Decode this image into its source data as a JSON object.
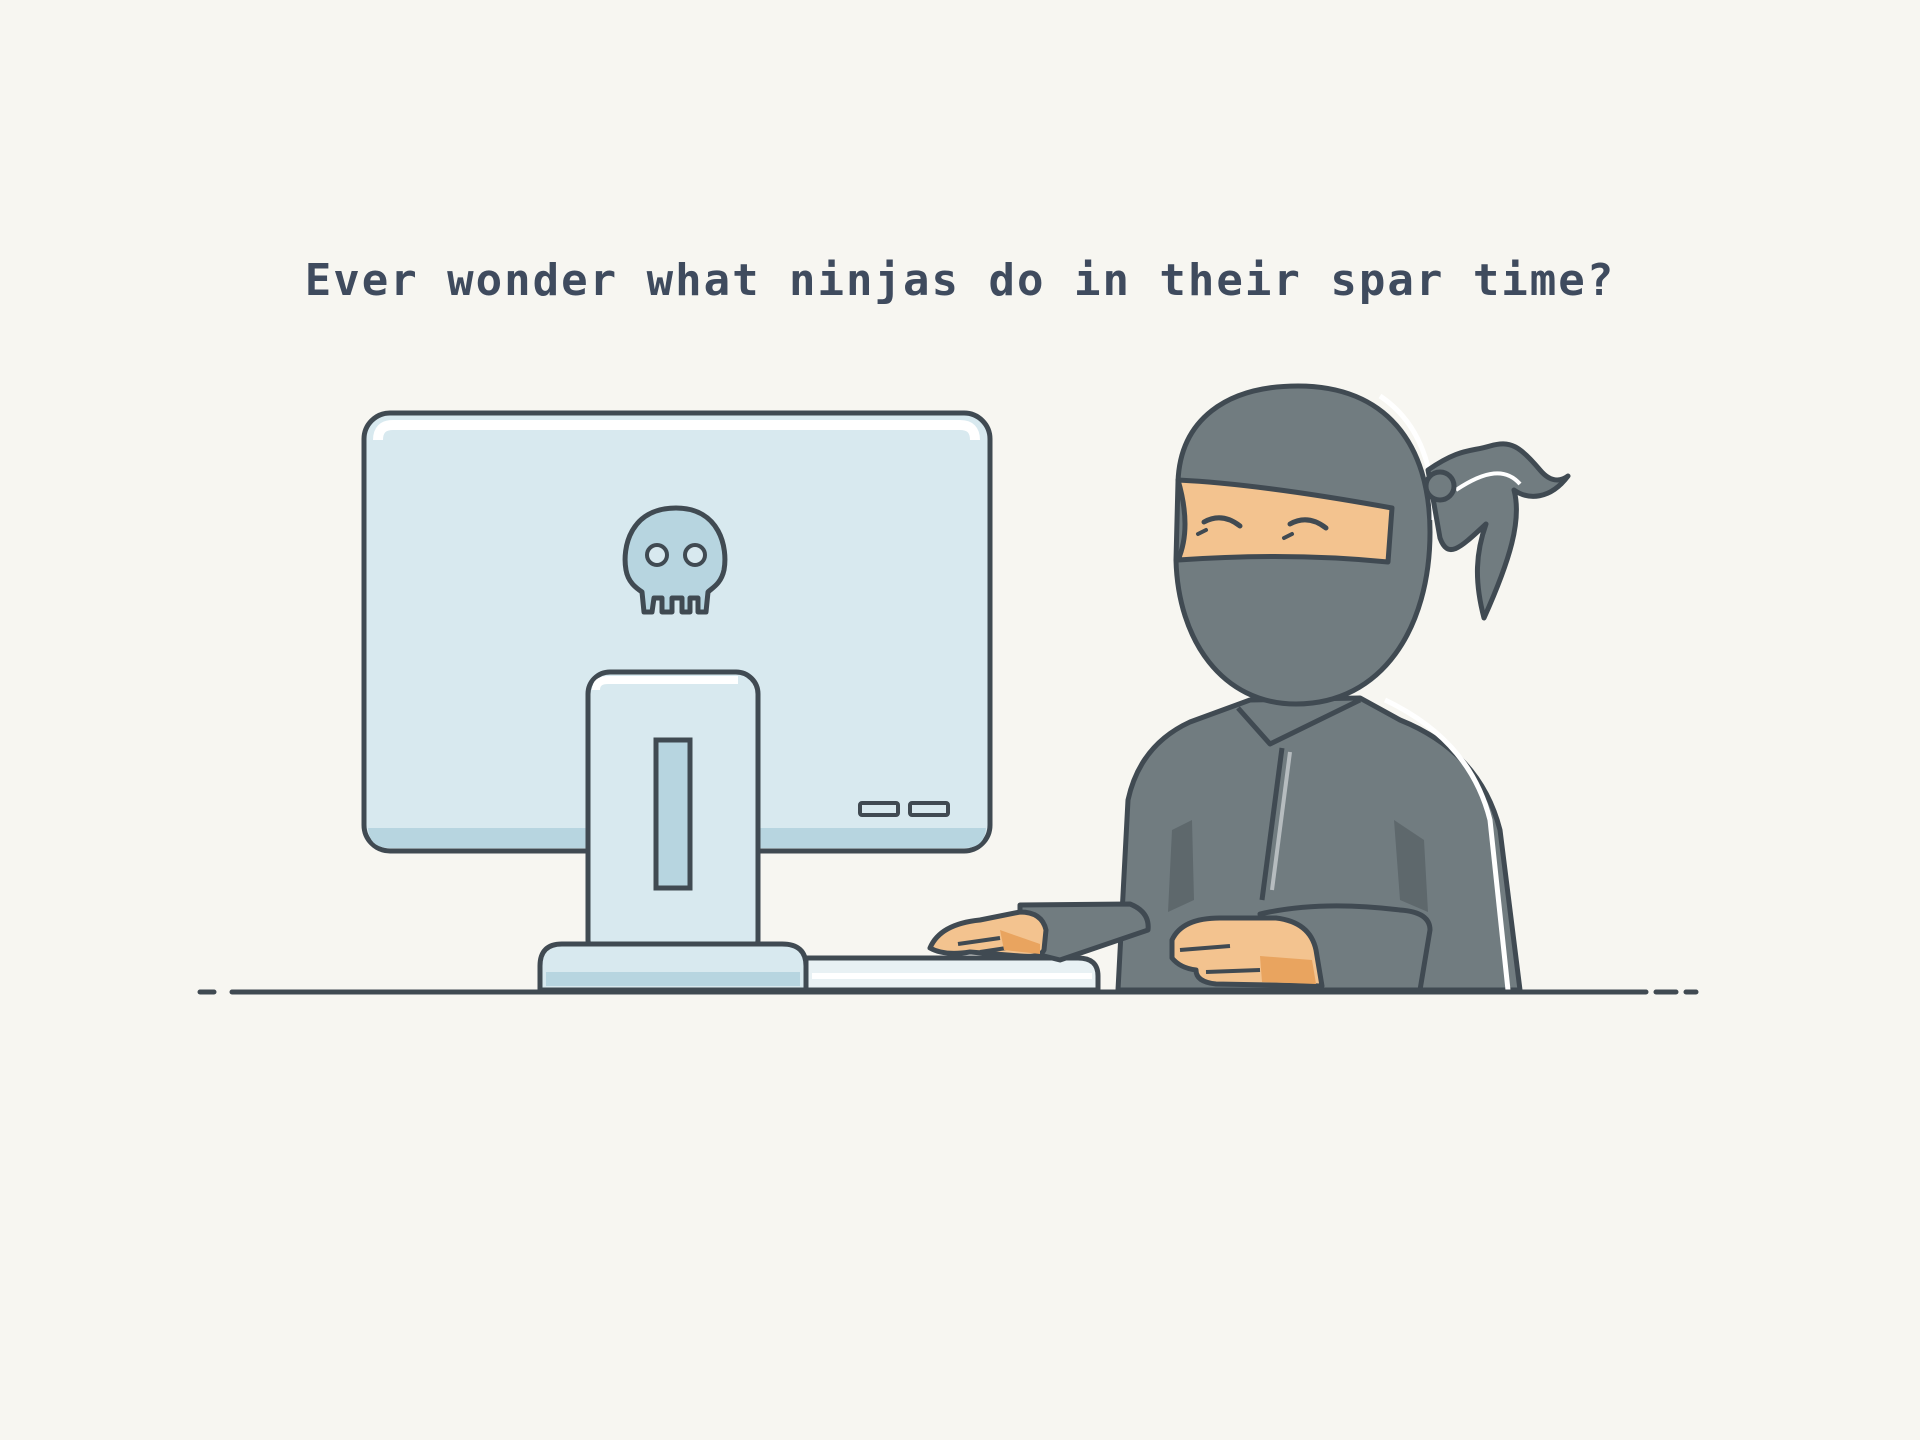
{
  "headline": "Ever wonder what ninjas do in their spar time?",
  "illustration": {
    "subject": "ninja",
    "computer_icon": "skull-icon"
  },
  "colors": {
    "background": "#f7f6f1",
    "text": "#3f4b5e",
    "outline": "#404a52",
    "screen": "#d8e9ef",
    "screen_shadow": "#b7d5e0",
    "ninja_suit": "#717c80",
    "ninja_suit_dark": "#5e686c",
    "skin": "#f3c38f",
    "skin_dark": "#e9a45f"
  }
}
